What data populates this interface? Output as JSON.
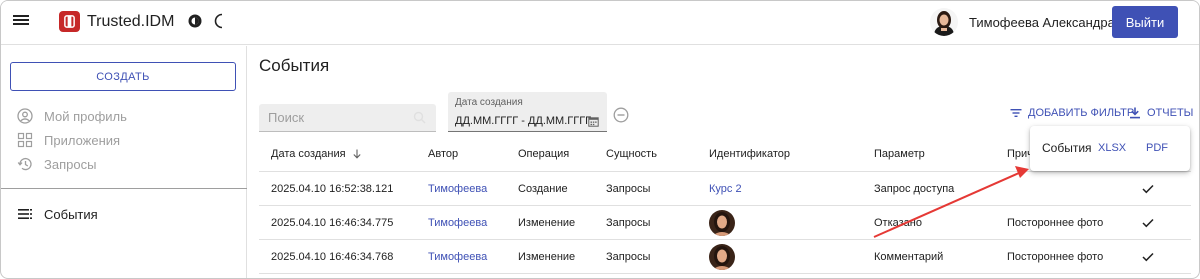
{
  "header": {
    "app_title": "Trusted.IDM",
    "user_name": "Тимофеева Александра",
    "logout_label": "Выйти"
  },
  "sidebar": {
    "create_label": "СОЗДАТЬ",
    "items": [
      {
        "label": "Мой профиль",
        "icon": "user-circle-icon"
      },
      {
        "label": "Приложения",
        "icon": "apps-grid-icon"
      },
      {
        "label": "Запросы",
        "icon": "history-icon"
      },
      {
        "label": "События",
        "icon": "list-icon"
      }
    ]
  },
  "main": {
    "title": "События",
    "search_placeholder": "Поиск",
    "date_label": "Дата создания",
    "date_value": "ДД.ММ.ГГГГ - ДД.ММ.ГГГГ",
    "add_filter_label": "ДОБАВИТЬ ФИЛЬТР",
    "reports_label": "ОТЧЕТЫ"
  },
  "table": {
    "columns": [
      "Дата создания",
      "Автор",
      "Операция",
      "Сущность",
      "Идентификатор",
      "Параметр",
      "Прич"
    ],
    "rows": [
      {
        "date": "2025.04.10 16:52:38.121",
        "author": "Тимофеева",
        "operation": "Создание",
        "entity": "Запросы",
        "identifier": "Курс 2",
        "parameter": "Запрос доступа",
        "reason": "",
        "checked": true
      },
      {
        "date": "2025.04.10 16:46:34.775",
        "author": "Тимофеева",
        "operation": "Изменение",
        "entity": "Запросы",
        "identifier": "",
        "parameter": "Отказано",
        "reason": "Постороннее фото",
        "checked": true
      },
      {
        "date": "2025.04.10 16:46:34.768",
        "author": "Тимофеева",
        "operation": "Изменение",
        "entity": "Запросы",
        "identifier": "",
        "parameter": "Комментарий",
        "reason": "Постороннее фото",
        "checked": true
      }
    ]
  },
  "reports_popup": {
    "label": "События",
    "xlsx_label": "XLSX",
    "pdf_label": "PDF"
  },
  "colors": {
    "accent": "#3f51b5",
    "logo": "#c62828",
    "annotation_arrow": "#e53935"
  }
}
